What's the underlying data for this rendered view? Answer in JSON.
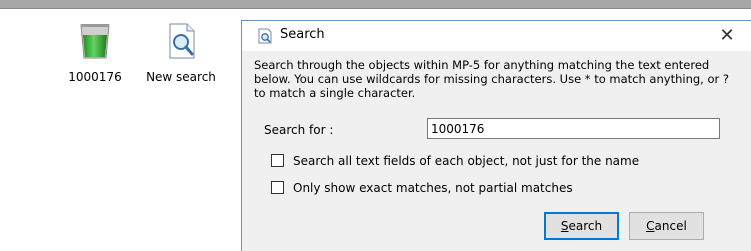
{
  "desktop": {
    "items": [
      {
        "label": "1000176",
        "icon": "green-bin-icon"
      },
      {
        "label": "New search",
        "icon": "search-document-icon"
      }
    ]
  },
  "dialog": {
    "title": "Search",
    "title_icon": "search-document-icon",
    "close_glyph": "✕",
    "description": "Search through the objects within MP-5 for anything matching the text entered below. You can use wildcards for missing characters. Use  * to match anything, or ? to match a single character.",
    "search_label": "Search for :",
    "search_value": "1000176",
    "checkbox_all_fields": {
      "label": "Search all text fields of each object, not just for the name",
      "checked": false
    },
    "checkbox_exact": {
      "label": "Only show exact matches, not partial matches",
      "checked": false
    },
    "search_button": {
      "mnemonic": "S",
      "rest": "earch"
    },
    "cancel_button": {
      "mnemonic": "C",
      "rest": "ancel"
    }
  },
  "colors": {
    "title_border": "#6d8fc0",
    "focus": "#0078d7",
    "bin_green": "#3cb43c"
  }
}
